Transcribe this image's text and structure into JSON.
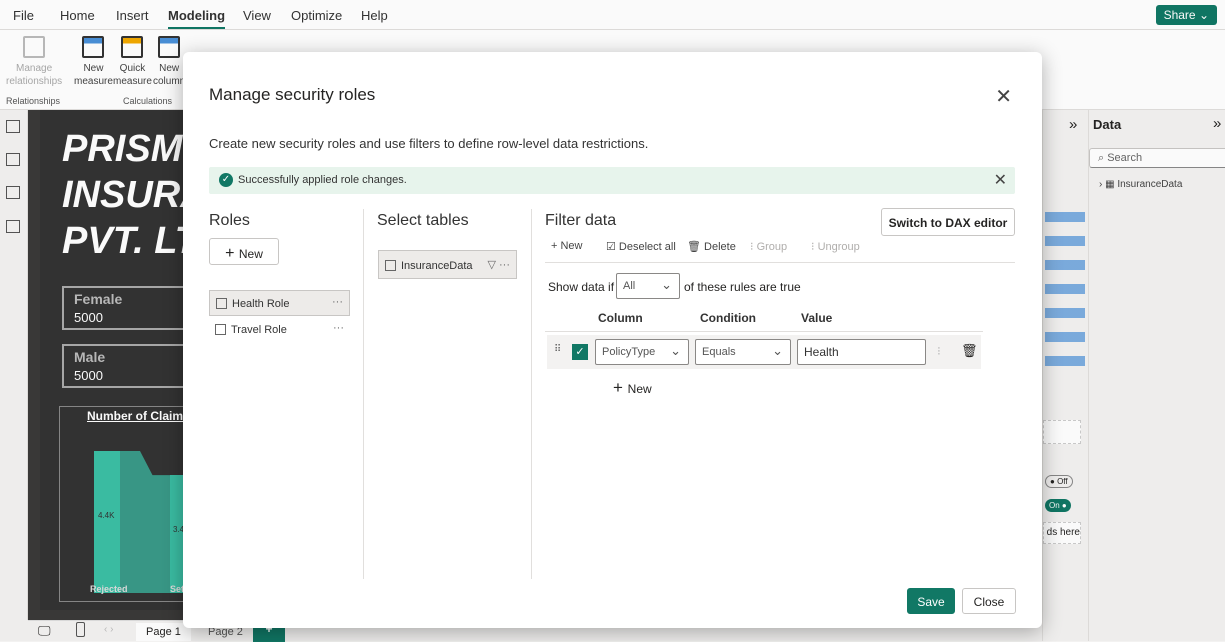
{
  "menu": [
    "File",
    "Home",
    "Insert",
    "Modeling",
    "View",
    "Optimize",
    "Help"
  ],
  "share": "Share",
  "ribbon": {
    "manage_relationships": [
      "Manage",
      "relationships"
    ],
    "new_measure": [
      "New",
      "measure"
    ],
    "quick_measure": [
      "Quick",
      "measure"
    ],
    "new_column": [
      "New",
      "column"
    ],
    "groups": [
      "Relationships",
      "Calculations"
    ]
  },
  "report": {
    "title": "PRISM\nINSURA\nPVT. LT",
    "cards": [
      {
        "label": "Female",
        "value": "5000"
      },
      {
        "label": "Male",
        "value": "5000"
      }
    ],
    "chart_title": "Number of Claim",
    "bar_labels": [
      "4.4K",
      "3.4"
    ],
    "categories": [
      "Rejected",
      "Set"
    ]
  },
  "pages": [
    "Page 1",
    "Page 2"
  ],
  "data_pane": {
    "title": "Data",
    "search_placeholder": "Search",
    "table": "InsuranceData"
  },
  "toggles": {
    "off": "Off",
    "on": "On",
    "drop": "ds here"
  },
  "dialog": {
    "title": "Manage security roles",
    "description": "Create new security roles and use filters to define row-level data restrictions.",
    "banner": "Successfully applied role changes.",
    "roles_title": "Roles",
    "new_role": "New",
    "roles": [
      "Health Role",
      "Travel Role"
    ],
    "tables_title": "Select tables",
    "table": "InsuranceData",
    "filter_title": "Filter data",
    "dax_button": "Switch to DAX editor",
    "toolbar": {
      "new": "New",
      "deselect": "Deselect all",
      "delete": "Delete",
      "group": "Group",
      "ungroup": "Ungroup"
    },
    "show_if": "Show data if",
    "match": "All",
    "rules_suffix": "of these rules are true",
    "headers": {
      "column": "Column",
      "condition": "Condition",
      "value": "Value"
    },
    "rule": {
      "column": "PolicyType",
      "condition": "Equals",
      "value": "Health"
    },
    "new_rule": "New",
    "save": "Save",
    "close": "Close"
  }
}
